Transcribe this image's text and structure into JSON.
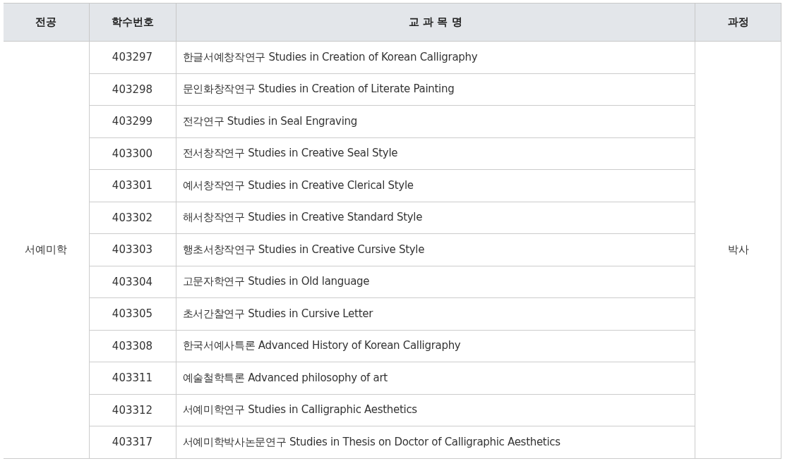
{
  "table": {
    "columns": [
      "전공",
      "학수번호",
      "교 과 목 명",
      "과정"
    ],
    "major": "서예미학",
    "program": "박사",
    "rows": [
      {
        "code": "403297",
        "course": "한글서예창작연구 Studies in Creation of Korean Calligraphy"
      },
      {
        "code": "403298",
        "course": "문인화창작연구 Studies in Creation of Literate Painting"
      },
      {
        "code": "403299",
        "course": "전각연구 Studies in Seal Engraving"
      },
      {
        "code": "403300",
        "course": "전서창작연구 Studies in Creative Seal Style"
      },
      {
        "code": "403301",
        "course": "예서창작연구 Studies in Creative Clerical Style"
      },
      {
        "code": "403302",
        "course": "해서창작연구 Studies in Creative Standard Style"
      },
      {
        "code": "403303",
        "course": "행초서창작연구 Studies in Creative Cursive Style"
      },
      {
        "code": "403304",
        "course": "고문자학연구 Studies in Old language"
      },
      {
        "code": "403305",
        "course": "초서간찰연구 Studies in Cursive Letter"
      },
      {
        "code": "403308",
        "course": "한국서예사특론 Advanced History of Korean Calligraphy"
      },
      {
        "code": "403311",
        "course": "예술철학특론 Advanced philosophy of art"
      },
      {
        "code": "403312",
        "course": "서예미학연구 Studies in Calligraphic Aesthetics"
      },
      {
        "code": "403317",
        "course": "서예미학박사논문연구 Studies in Thesis on Doctor of Calligraphic Aesthetics"
      }
    ]
  }
}
